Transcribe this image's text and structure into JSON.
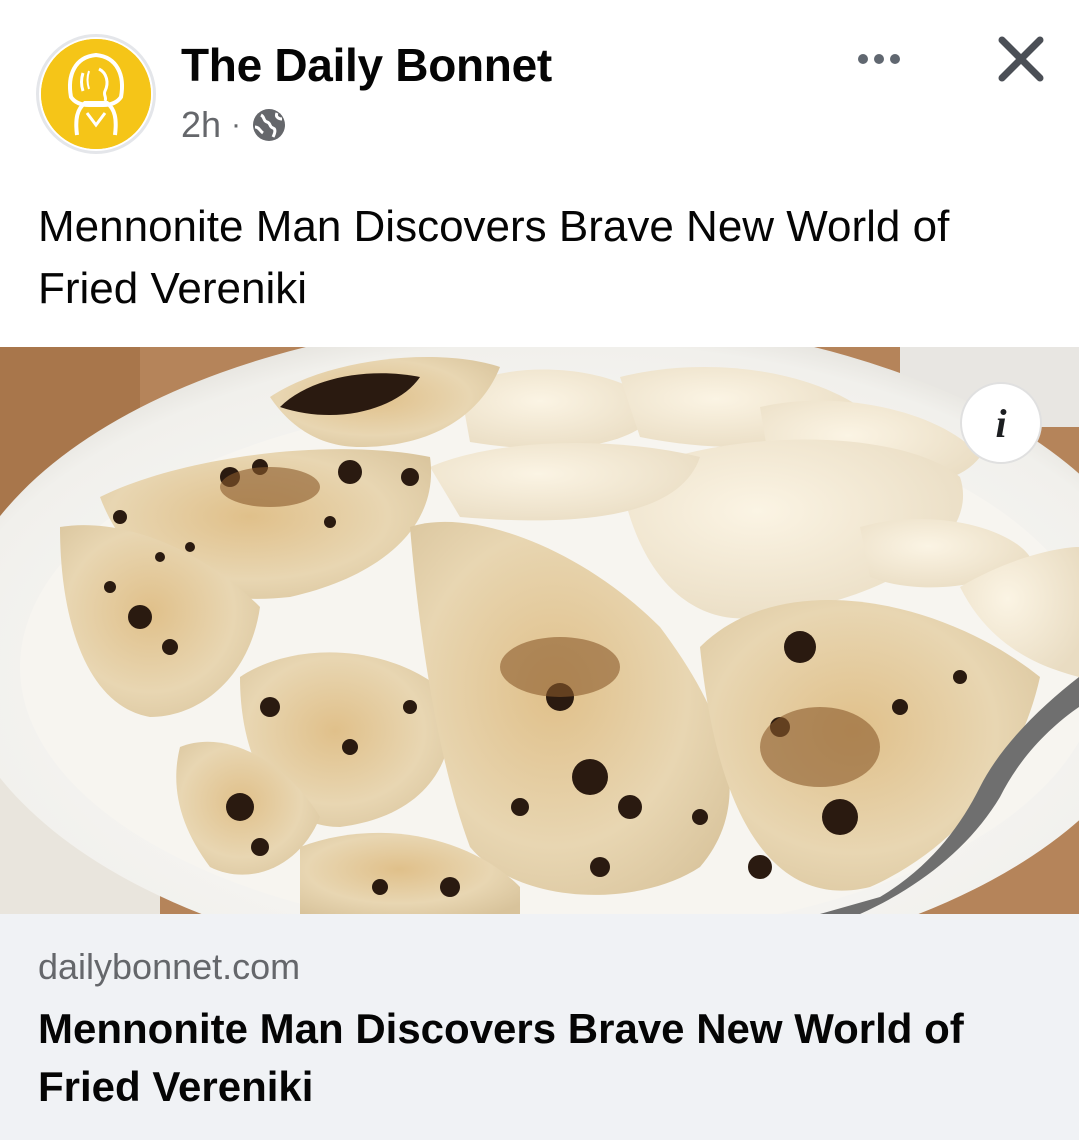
{
  "post": {
    "page_name": "The Daily Bonnet",
    "timestamp": "2h",
    "separator": "·",
    "privacy_icon": "globe-icon",
    "text": "Mennonite Man Discovers Brave New World of Fried Vereniki"
  },
  "actions": {
    "more_icon": "more-horizontal-icon",
    "close_icon": "close-icon",
    "info_label": "i"
  },
  "link_preview": {
    "domain": "dailybonnet.com",
    "title": "Mennonite Man Discovers Brave New World of Fried Vereniki"
  },
  "colors": {
    "brand_yellow": "#f5c518",
    "secondary_text": "#65676b",
    "preview_background": "#f0f2f5"
  }
}
